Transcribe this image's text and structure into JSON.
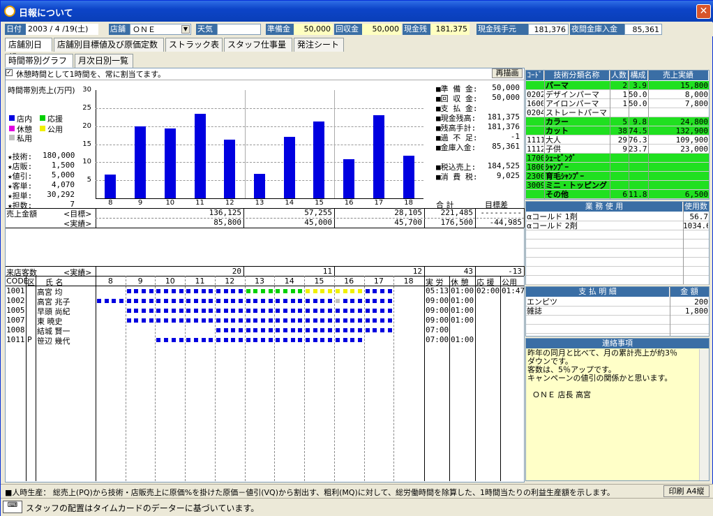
{
  "window": {
    "title": "日報について",
    "close": "✕"
  },
  "header": {
    "date_label": "日付",
    "date_value": "2003 / 4 /19(土)",
    "store_label": "店舗",
    "store_value": "ＯＮＥ",
    "weather_label": "天気",
    "weather_value": "",
    "prep_label": "準備金",
    "prep_value": "50,000",
    "collect_label": "回収金",
    "collect_value": "50,000",
    "cash_label": "現金残",
    "cash_value": "181,375",
    "handcash_label": "現金残手元",
    "handcash_value": "181,376",
    "night_label": "夜間金庫入金",
    "night_value": "85,361"
  },
  "tabs": [
    "店舗別日報",
    "店舗別目標値及び原価定数",
    "ストラック表",
    "スタッフ仕事量",
    "発注シート"
  ],
  "subtabs": [
    "時間帯別グラフ",
    "月次日別一覧"
  ],
  "checkbox_label": "休憩時間として1時間を、常に割当てます。",
  "redraw_button": "再描画",
  "chart_title": "時間帯別売上(万円)",
  "legend": [
    {
      "name": "店内",
      "color": "#0000e0"
    },
    {
      "name": "応援",
      "color": "#00d000"
    },
    {
      "name": "休憩",
      "color": "#e000e0"
    },
    {
      "name": "公用",
      "color": "#f0f000"
    },
    {
      "name": "私用",
      "color": "#c0c0c0"
    }
  ],
  "stats": [
    {
      "label": "★技術:",
      "value": "180,000"
    },
    {
      "label": "★店販:",
      "value": "1,500"
    },
    {
      "label": "★値引:",
      "value": "5,000"
    },
    {
      "label": "★客単:",
      "value": "4,070"
    },
    {
      "label": "★担単:",
      "value": "30,292"
    },
    {
      "label": "★担数:",
      "value": "7"
    }
  ],
  "chart_data": {
    "type": "bar",
    "categories": [
      "8",
      "9",
      "10",
      "11",
      "12",
      "13",
      "14",
      "15",
      "16",
      "17",
      "18"
    ],
    "values": [
      6.5,
      20,
      19.3,
      23.5,
      16.2,
      6.8,
      17,
      21.3,
      10.8,
      23.1,
      11.8
    ],
    "ylim": [
      0,
      30
    ],
    "yticks": [
      "30",
      "25",
      "20",
      "15",
      "10",
      "5"
    ],
    "title": "時間帯別売上(万円)"
  },
  "money": [
    {
      "label": "■準 備 金:",
      "value": "50,000"
    },
    {
      "label": "■回 収 金:",
      "value": "50,000"
    },
    {
      "label": "■支 払 金:",
      "value": ""
    },
    {
      "label": "■現金残高:",
      "value": "181,375"
    },
    {
      "label": "■残高手計:",
      "value": "181,376"
    },
    {
      "label": "■過 不 足:",
      "value": "-1"
    },
    {
      "label": "■金庫入金:",
      "value": "85,361"
    },
    {
      "label": "■税込売上:",
      "value": "184,525"
    },
    {
      "label": "■消 費 税:",
      "value": "9,025"
    }
  ],
  "sales": {
    "label": "売上金額",
    "target_label": "<目標>",
    "actual_label": "<実績>",
    "sum_label": "合 計",
    "diff_label": "目標差",
    "target": [
      "136,125",
      "57,255",
      "28,105",
      "221,485",
      "---------"
    ],
    "actual": [
      "85,800",
      "45,000",
      "45,700",
      "176,500",
      "-44,985"
    ]
  },
  "visitors": {
    "label": "来店客数",
    "actual_label": "<実績>",
    "values": [
      "20",
      "11",
      "12",
      "43",
      "-13"
    ]
  },
  "staff_header": {
    "code": "CODE",
    "kubun": "区",
    "name": "氏 名",
    "hours": [
      "8",
      "9",
      "10",
      "11",
      "12",
      "13",
      "14",
      "15",
      "16",
      "17",
      "18"
    ],
    "work": "実 労",
    "rest": "休 憩",
    "help": "応 援",
    "public": "公用"
  },
  "staff": [
    {
      "code": "1001",
      "kubun": "",
      "name": "高宮 均",
      "work": "05:13",
      "rest": "01:00",
      "help": "02:00",
      "public": "01:47"
    },
    {
      "code": "1002",
      "kubun": "",
      "name": "高宮 兆子",
      "work": "09:00",
      "rest": "01:00",
      "help": "",
      "public": ""
    },
    {
      "code": "1005",
      "kubun": "",
      "name": "早頭 尚紀",
      "work": "09:00",
      "rest": "01:00",
      "help": "",
      "public": ""
    },
    {
      "code": "1007",
      "kubun": "",
      "name": "東 暁史",
      "work": "09:00",
      "rest": "01:00",
      "help": "",
      "public": ""
    },
    {
      "code": "1008",
      "kubun": "",
      "name": "結城 賢一",
      "work": "07:00",
      "rest": "",
      "help": "",
      "public": ""
    },
    {
      "code": "1011",
      "kubun": "P",
      "name": "笹辺 幾代",
      "work": "07:00",
      "rest": "01:00",
      "help": "",
      "public": ""
    }
  ],
  "tech_table": {
    "headers": [
      "ｺｰﾄﾞ",
      "技術分類名称",
      "人数",
      "構成",
      "売上実績"
    ],
    "rows": [
      {
        "code": "",
        "name": "パーマ",
        "n": "2",
        "r": "3.9",
        "amt": "15,800",
        "green": true
      },
      {
        "code": "0202",
        "name": "デザインパーマ",
        "n": "1",
        "r": "50.0",
        "amt": "8,000",
        "green": false
      },
      {
        "code": "1600",
        "name": "アイロンパーマ",
        "n": "1",
        "r": "50.0",
        "amt": "7,800",
        "green": false
      },
      {
        "code": "0204",
        "name": "ストレートパーマ",
        "n": "",
        "r": "",
        "amt": "",
        "green": false
      },
      {
        "code": "",
        "name": "カラー",
        "n": "5",
        "r": "9.8",
        "amt": "24,800",
        "green": true
      },
      {
        "code": "",
        "name": "カット",
        "n": "38",
        "r": "74.5",
        "amt": "132,900",
        "green": true
      },
      {
        "code": "1111",
        "name": "大人",
        "n": "29",
        "r": "76.3",
        "amt": "109,900",
        "green": false
      },
      {
        "code": "1112",
        "name": "子供",
        "n": "9",
        "r": "23.7",
        "amt": "23,000",
        "green": false
      },
      {
        "code": "1700",
        "name": "ｼｪｰﾋﾞﾝｸﾞ",
        "n": "",
        "r": "",
        "amt": "",
        "green": true
      },
      {
        "code": "1800",
        "name": "ｼｬﾝﾌﾟｰ",
        "n": "",
        "r": "",
        "amt": "",
        "green": true
      },
      {
        "code": "2300",
        "name": "育毛ｼｬﾝﾌﾟｰ",
        "n": "",
        "r": "",
        "amt": "",
        "green": true
      },
      {
        "code": "3009",
        "name": "ミニ・トッピング",
        "n": "",
        "r": "",
        "amt": "",
        "green": true
      },
      {
        "code": "",
        "name": "その他",
        "n": "6",
        "r": "11.8",
        "amt": "6,500",
        "green": true
      }
    ]
  },
  "usage_table": {
    "headers": [
      "業 務 使 用",
      "使用数"
    ],
    "rows": [
      {
        "name": "αコールド 1剤",
        "v": "56.7"
      },
      {
        "name": "αコールド 2剤",
        "v": "1034.6"
      }
    ]
  },
  "pay_table": {
    "headers": [
      "支 払 明 細",
      "金 額"
    ],
    "rows": [
      {
        "name": "エンピツ",
        "v": "200"
      },
      {
        "name": "雑誌",
        "v": "1,800"
      }
    ]
  },
  "notes": {
    "title": "連絡事項",
    "lines": [
      "昨年の同月と比べて、月の累計売上が約3％",
      "ダウンです。",
      "客数は、5％アップです。",
      "キャンペーンの値引の関係かと思います。",
      "",
      "  ＯＮＥ 店長 高宮"
    ]
  },
  "status1": "■人時生産： 総売上(PQ)から技術・店販売上に原価%を掛けた原価－値引(VQ)から割出す、粗利(MQ)に対して、総労働時間を除算した、1時間当たりの利益生産額を示します。",
  "print_button": "印刷 A4縦",
  "status2": "スタッフの配置はタイムカードのデーターに基づいています。"
}
